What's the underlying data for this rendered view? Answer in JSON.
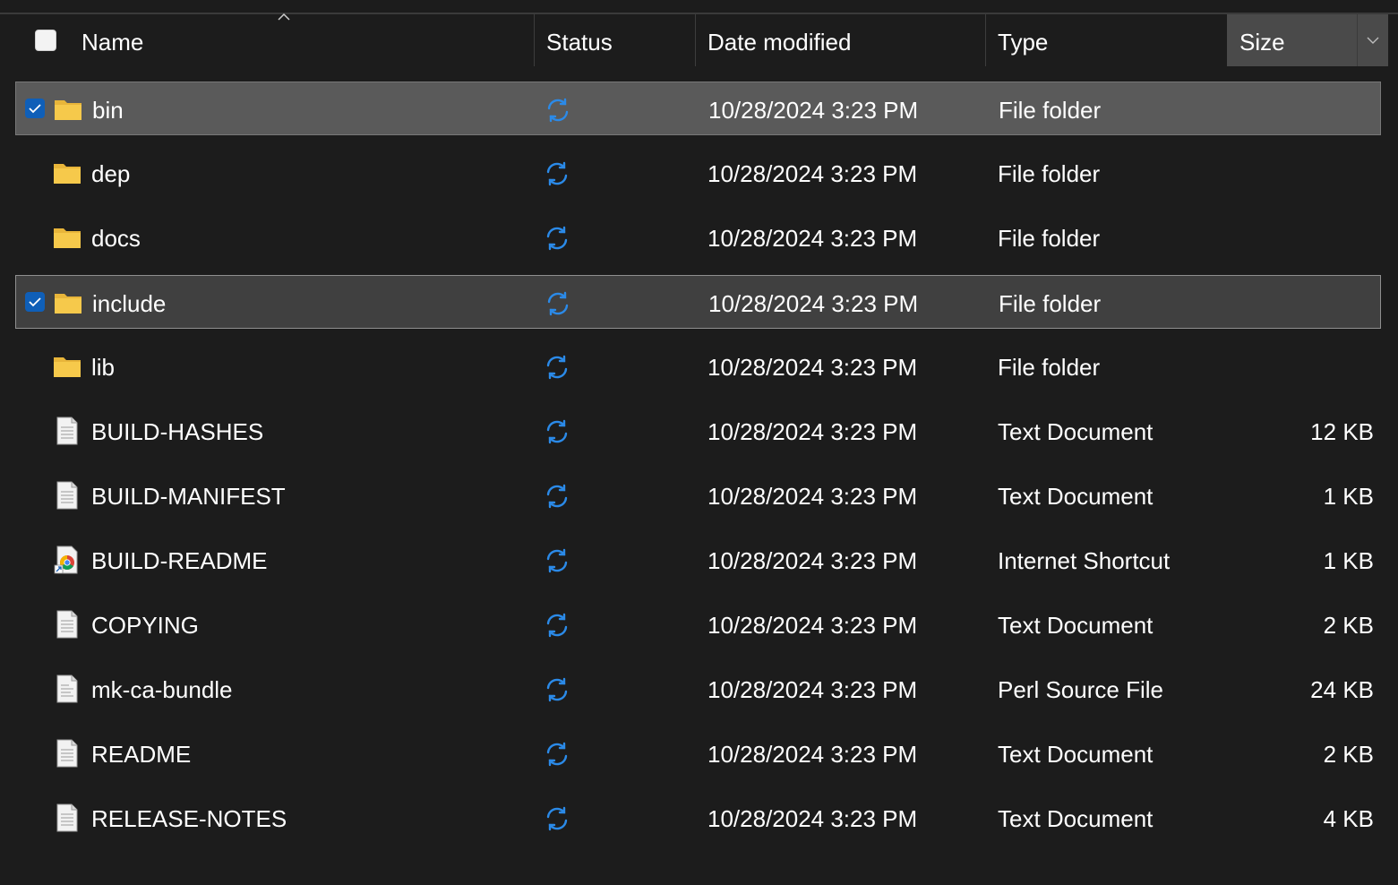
{
  "columns": {
    "name": "Name",
    "status": "Status",
    "date": "Date modified",
    "type": "Type",
    "size": "Size"
  },
  "colors": {
    "background": "#1c1c1c",
    "selected_row": "#5a5a5a",
    "checkbox_accent": "#0f5fb8",
    "sync_icon": "#2b8ae8",
    "folder": "#f6c94b"
  },
  "rows": [
    {
      "name": "bin",
      "icon": "folder-icon",
      "date": "10/28/2024 3:23 PM",
      "type": "File folder",
      "size": "",
      "checked": true
    },
    {
      "name": "dep",
      "icon": "folder-icon",
      "date": "10/28/2024 3:23 PM",
      "type": "File folder",
      "size": "",
      "checked": false
    },
    {
      "name": "docs",
      "icon": "folder-icon",
      "date": "10/28/2024 3:23 PM",
      "type": "File folder",
      "size": "",
      "checked": false
    },
    {
      "name": "include",
      "icon": "folder-icon",
      "date": "10/28/2024 3:23 PM",
      "type": "File folder",
      "size": "",
      "checked": true
    },
    {
      "name": "lib",
      "icon": "folder-icon",
      "date": "10/28/2024 3:23 PM",
      "type": "File folder",
      "size": "",
      "checked": false
    },
    {
      "name": "BUILD-HASHES",
      "icon": "text-document-icon",
      "date": "10/28/2024 3:23 PM",
      "type": "Text Document",
      "size": "12 KB",
      "checked": false
    },
    {
      "name": "BUILD-MANIFEST",
      "icon": "text-document-icon",
      "date": "10/28/2024 3:23 PM",
      "type": "Text Document",
      "size": "1 KB",
      "checked": false
    },
    {
      "name": "BUILD-README",
      "icon": "internet-shortcut-icon",
      "date": "10/28/2024 3:23 PM",
      "type": "Internet Shortcut",
      "size": "1 KB",
      "checked": false
    },
    {
      "name": "COPYING",
      "icon": "text-document-icon",
      "date": "10/28/2024 3:23 PM",
      "type": "Text Document",
      "size": "2 KB",
      "checked": false
    },
    {
      "name": "mk-ca-bundle",
      "icon": "perl-file-icon",
      "date": "10/28/2024 3:23 PM",
      "type": "Perl Source File",
      "size": "24 KB",
      "checked": false
    },
    {
      "name": "README",
      "icon": "text-document-icon",
      "date": "10/28/2024 3:23 PM",
      "type": "Text Document",
      "size": "2 KB",
      "checked": false
    },
    {
      "name": "RELEASE-NOTES",
      "icon": "text-document-icon",
      "date": "10/28/2024 3:23 PM",
      "type": "Text Document",
      "size": "4 KB",
      "checked": false
    }
  ]
}
